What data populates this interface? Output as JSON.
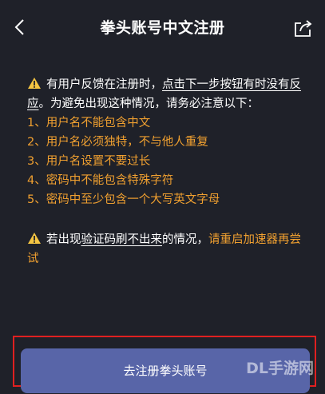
{
  "header": {
    "title": "拳头账号中文注册",
    "back_icon": "chevron-left-icon",
    "share_icon": "share-icon"
  },
  "notice1": {
    "icon": "warning-icon",
    "text_a": "有用户反馈在注册时，",
    "text_b_underlined": "点击下一步按钮有时没有反应",
    "text_c": "。为避免出现这种情况，请务必注意以下："
  },
  "rules": [
    "1、用户名不能包含中文",
    "2、用户名必须独特，不与他人重复",
    "3、用户名设置不要过长",
    "4、密码中不能包含特殊字符",
    "5、密码中至少包含一个大写英文字母"
  ],
  "notice2": {
    "icon": "warning-icon",
    "text_a": "若出现",
    "text_b_underlined": "验证码刷不出来",
    "text_c": "的情况，",
    "text_d_orange": "请重启加速器再尝试"
  },
  "cta": {
    "label": "去注册拳头账号"
  },
  "watermark": "DL手游网",
  "colors": {
    "background": "#1f2129",
    "accent_orange": "#f0a030",
    "button": "#5865a8",
    "highlight_border": "#e02020"
  }
}
